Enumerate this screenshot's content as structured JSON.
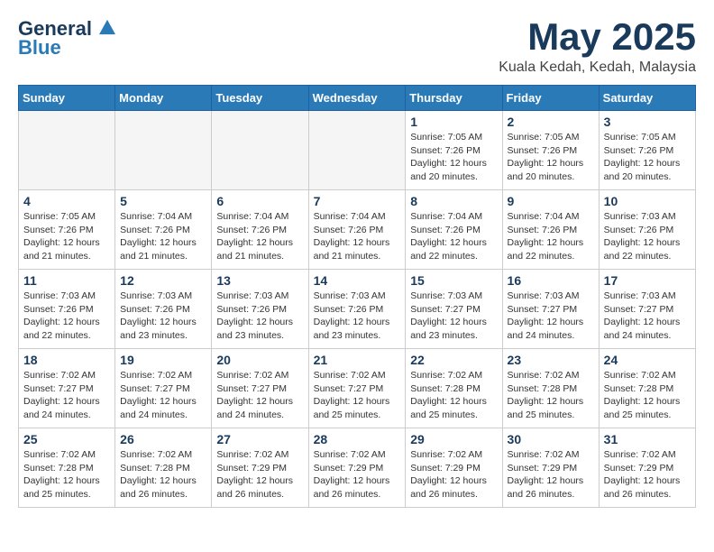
{
  "header": {
    "logo_line1": "General",
    "logo_line2": "Blue",
    "month_title": "May 2025",
    "location": "Kuala Kedah, Kedah, Malaysia"
  },
  "weekdays": [
    "Sunday",
    "Monday",
    "Tuesday",
    "Wednesday",
    "Thursday",
    "Friday",
    "Saturday"
  ],
  "weeks": [
    [
      {
        "day": "",
        "info": ""
      },
      {
        "day": "",
        "info": ""
      },
      {
        "day": "",
        "info": ""
      },
      {
        "day": "",
        "info": ""
      },
      {
        "day": "1",
        "info": "Sunrise: 7:05 AM\nSunset: 7:26 PM\nDaylight: 12 hours and 20 minutes."
      },
      {
        "day": "2",
        "info": "Sunrise: 7:05 AM\nSunset: 7:26 PM\nDaylight: 12 hours and 20 minutes."
      },
      {
        "day": "3",
        "info": "Sunrise: 7:05 AM\nSunset: 7:26 PM\nDaylight: 12 hours and 20 minutes."
      }
    ],
    [
      {
        "day": "4",
        "info": "Sunrise: 7:05 AM\nSunset: 7:26 PM\nDaylight: 12 hours and 21 minutes."
      },
      {
        "day": "5",
        "info": "Sunrise: 7:04 AM\nSunset: 7:26 PM\nDaylight: 12 hours and 21 minutes."
      },
      {
        "day": "6",
        "info": "Sunrise: 7:04 AM\nSunset: 7:26 PM\nDaylight: 12 hours and 21 minutes."
      },
      {
        "day": "7",
        "info": "Sunrise: 7:04 AM\nSunset: 7:26 PM\nDaylight: 12 hours and 21 minutes."
      },
      {
        "day": "8",
        "info": "Sunrise: 7:04 AM\nSunset: 7:26 PM\nDaylight: 12 hours and 22 minutes."
      },
      {
        "day": "9",
        "info": "Sunrise: 7:04 AM\nSunset: 7:26 PM\nDaylight: 12 hours and 22 minutes."
      },
      {
        "day": "10",
        "info": "Sunrise: 7:03 AM\nSunset: 7:26 PM\nDaylight: 12 hours and 22 minutes."
      }
    ],
    [
      {
        "day": "11",
        "info": "Sunrise: 7:03 AM\nSunset: 7:26 PM\nDaylight: 12 hours and 22 minutes."
      },
      {
        "day": "12",
        "info": "Sunrise: 7:03 AM\nSunset: 7:26 PM\nDaylight: 12 hours and 23 minutes."
      },
      {
        "day": "13",
        "info": "Sunrise: 7:03 AM\nSunset: 7:26 PM\nDaylight: 12 hours and 23 minutes."
      },
      {
        "day": "14",
        "info": "Sunrise: 7:03 AM\nSunset: 7:26 PM\nDaylight: 12 hours and 23 minutes."
      },
      {
        "day": "15",
        "info": "Sunrise: 7:03 AM\nSunset: 7:27 PM\nDaylight: 12 hours and 23 minutes."
      },
      {
        "day": "16",
        "info": "Sunrise: 7:03 AM\nSunset: 7:27 PM\nDaylight: 12 hours and 24 minutes."
      },
      {
        "day": "17",
        "info": "Sunrise: 7:03 AM\nSunset: 7:27 PM\nDaylight: 12 hours and 24 minutes."
      }
    ],
    [
      {
        "day": "18",
        "info": "Sunrise: 7:02 AM\nSunset: 7:27 PM\nDaylight: 12 hours and 24 minutes."
      },
      {
        "day": "19",
        "info": "Sunrise: 7:02 AM\nSunset: 7:27 PM\nDaylight: 12 hours and 24 minutes."
      },
      {
        "day": "20",
        "info": "Sunrise: 7:02 AM\nSunset: 7:27 PM\nDaylight: 12 hours and 24 minutes."
      },
      {
        "day": "21",
        "info": "Sunrise: 7:02 AM\nSunset: 7:27 PM\nDaylight: 12 hours and 25 minutes."
      },
      {
        "day": "22",
        "info": "Sunrise: 7:02 AM\nSunset: 7:28 PM\nDaylight: 12 hours and 25 minutes."
      },
      {
        "day": "23",
        "info": "Sunrise: 7:02 AM\nSunset: 7:28 PM\nDaylight: 12 hours and 25 minutes."
      },
      {
        "day": "24",
        "info": "Sunrise: 7:02 AM\nSunset: 7:28 PM\nDaylight: 12 hours and 25 minutes."
      }
    ],
    [
      {
        "day": "25",
        "info": "Sunrise: 7:02 AM\nSunset: 7:28 PM\nDaylight: 12 hours and 25 minutes."
      },
      {
        "day": "26",
        "info": "Sunrise: 7:02 AM\nSunset: 7:28 PM\nDaylight: 12 hours and 26 minutes."
      },
      {
        "day": "27",
        "info": "Sunrise: 7:02 AM\nSunset: 7:29 PM\nDaylight: 12 hours and 26 minutes."
      },
      {
        "day": "28",
        "info": "Sunrise: 7:02 AM\nSunset: 7:29 PM\nDaylight: 12 hours and 26 minutes."
      },
      {
        "day": "29",
        "info": "Sunrise: 7:02 AM\nSunset: 7:29 PM\nDaylight: 12 hours and 26 minutes."
      },
      {
        "day": "30",
        "info": "Sunrise: 7:02 AM\nSunset: 7:29 PM\nDaylight: 12 hours and 26 minutes."
      },
      {
        "day": "31",
        "info": "Sunrise: 7:02 AM\nSunset: 7:29 PM\nDaylight: 12 hours and 26 minutes."
      }
    ]
  ]
}
